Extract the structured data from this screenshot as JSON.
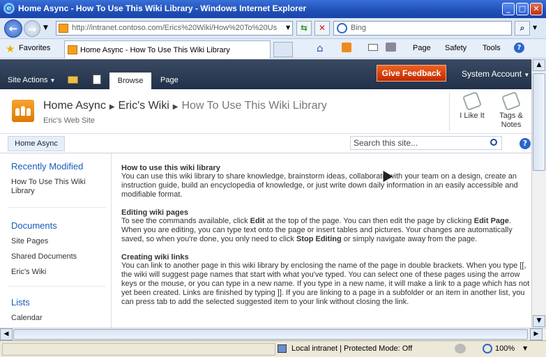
{
  "window": {
    "title": "Home Async - How To Use This Wiki Library - Windows Internet Explorer"
  },
  "browser": {
    "address": "http://intranet.contoso.com/Erics%20Wiki/How%20To%20Us",
    "search_placeholder": "Bing",
    "favorites_label": "Favorites",
    "tab_title": "Home Async - How To Use This Wiki Library",
    "command_bar": {
      "page": "Page",
      "safety": "Safety",
      "tools": "Tools"
    }
  },
  "ribbon": {
    "site_actions": "Site Actions",
    "tabs": [
      {
        "label": "Browse",
        "selected": true
      },
      {
        "label": "Page",
        "selected": false
      }
    ],
    "feedback": "Give Feedback",
    "account": "System Account"
  },
  "header": {
    "breadcrumb": [
      "Home Async",
      "Eric's Wiki",
      "How To Use This Wiki Library"
    ],
    "subtitle": "Eric's Web Site",
    "i_like_it": "I Like It",
    "tags_notes": "Tags & Notes"
  },
  "topnav": {
    "home": "Home Async",
    "search_placeholder": "Search this site..."
  },
  "leftnav": {
    "recently_modified": "Recently Modified",
    "recent_item": "How To Use This Wiki Library",
    "documents": "Documents",
    "doc_items": [
      "Site Pages",
      "Shared Documents",
      "Eric's Wiki"
    ],
    "lists": "Lists",
    "list_items": [
      "Calendar"
    ]
  },
  "content": {
    "s1_title": "How to use this wiki library",
    "s1_body": "You can use this wiki library to share knowledge, brainstorm ideas, collaborate with your team on a design, create an instruction guide, build an encyclopedia of knowledge, or just write down daily information in an easily accessible and modifiable format.",
    "s2_title": "Editing wiki pages",
    "s2_a": "To see the commands available, click ",
    "s2_b": "Edit",
    "s2_c": " at the top of the page. You can then edit the page by clicking ",
    "s2_d": "Edit Page",
    "s2_e": ". When you are editing, you can type text onto the page or insert tables and pictures. Your changes are automatically saved, so when you're done, you only need to click ",
    "s2_f": "Stop Editing",
    "s2_g": " or simply navigate away from the page.",
    "s3_title": "Creating wiki links",
    "s3_body": "You can link to another page in this wiki library by enclosing the name of the page in double brackets. When you type [[, the wiki will suggest page names that start with what you've typed. You can select one of these pages using the arrow keys or the mouse, or you can type in a new name. If you type in a new name, it will make a link to a page which has not yet been created. Links are finished by typing ]]. If you are linking to a page in a subfolder or an item in another list, you can press tab to add the selected suggested item to your link without closing the link."
  },
  "status": {
    "zone": "Local intranet | Protected Mode: Off",
    "zoom": "100%"
  }
}
